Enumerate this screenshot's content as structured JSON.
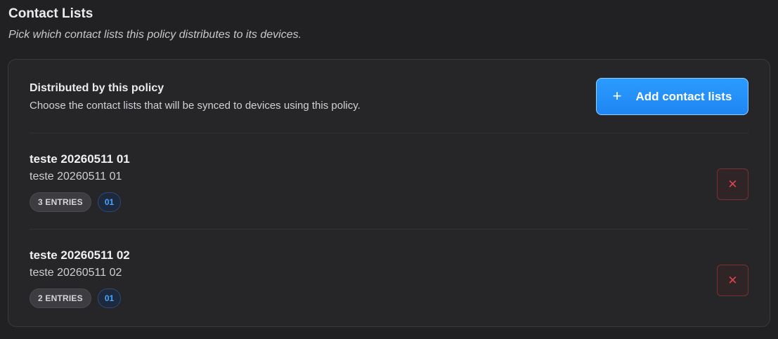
{
  "section": {
    "title": "Contact Lists",
    "subtitle": "Pick which contact lists this policy distributes to its devices."
  },
  "card": {
    "heading": "Distributed by this policy",
    "description": "Choose the contact lists that will be synced to devices using this policy.",
    "add_button": {
      "icon": "plus-icon",
      "icon_glyph": "+",
      "label": "Add contact lists"
    }
  },
  "lists": [
    {
      "title": "teste 20260511 01",
      "subtitle": "teste 20260511 01",
      "entries_badge": "3 ENTRIES",
      "code_badge": "01",
      "remove_icon": "close-icon",
      "remove_glyph": "✕"
    },
    {
      "title": "teste 20260511 02",
      "subtitle": "teste 20260511 02",
      "entries_badge": "2 ENTRIES",
      "code_badge": "01",
      "remove_icon": "close-icon",
      "remove_glyph": "✕"
    }
  ],
  "colors": {
    "accent": "#2b9bff",
    "danger": "#e0444c",
    "background": "#212123",
    "card": "#262629"
  }
}
